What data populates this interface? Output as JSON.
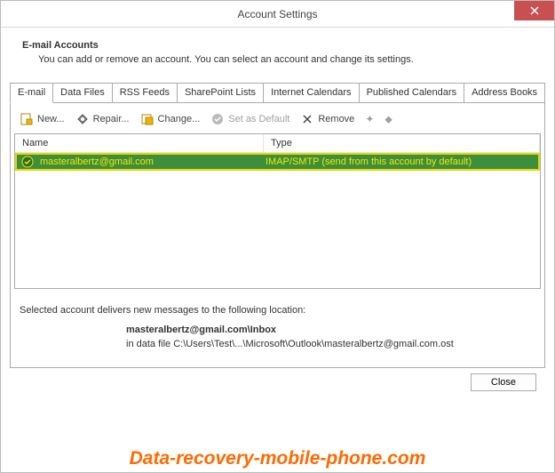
{
  "window": {
    "title": "Account Settings"
  },
  "header": {
    "title": "E-mail Accounts",
    "description": "You can add or remove an account. You can select an account and change its settings."
  },
  "tabs": [
    "E-mail",
    "Data Files",
    "RSS Feeds",
    "SharePoint Lists",
    "Internet Calendars",
    "Published Calendars",
    "Address Books"
  ],
  "toolbar": {
    "new": "New...",
    "repair": "Repair...",
    "change": "Change...",
    "set_default": "Set as Default",
    "remove": "Remove"
  },
  "list": {
    "columns": [
      "Name",
      "Type"
    ],
    "rows": [
      {
        "name": "masteralbertz@gmail.com",
        "type": "IMAP/SMTP (send from this account by default)"
      }
    ]
  },
  "footer": {
    "intro": "Selected account delivers new messages to the following location:",
    "location": "masteralbertz@gmail.com\\Inbox",
    "datafile": "in data file C:\\Users\\Test\\...\\Microsoft\\Outlook\\masteralbertz@gmail.com.ost"
  },
  "buttons": {
    "close": "Close"
  },
  "watermark": "Data-recovery-mobile-phone.com"
}
